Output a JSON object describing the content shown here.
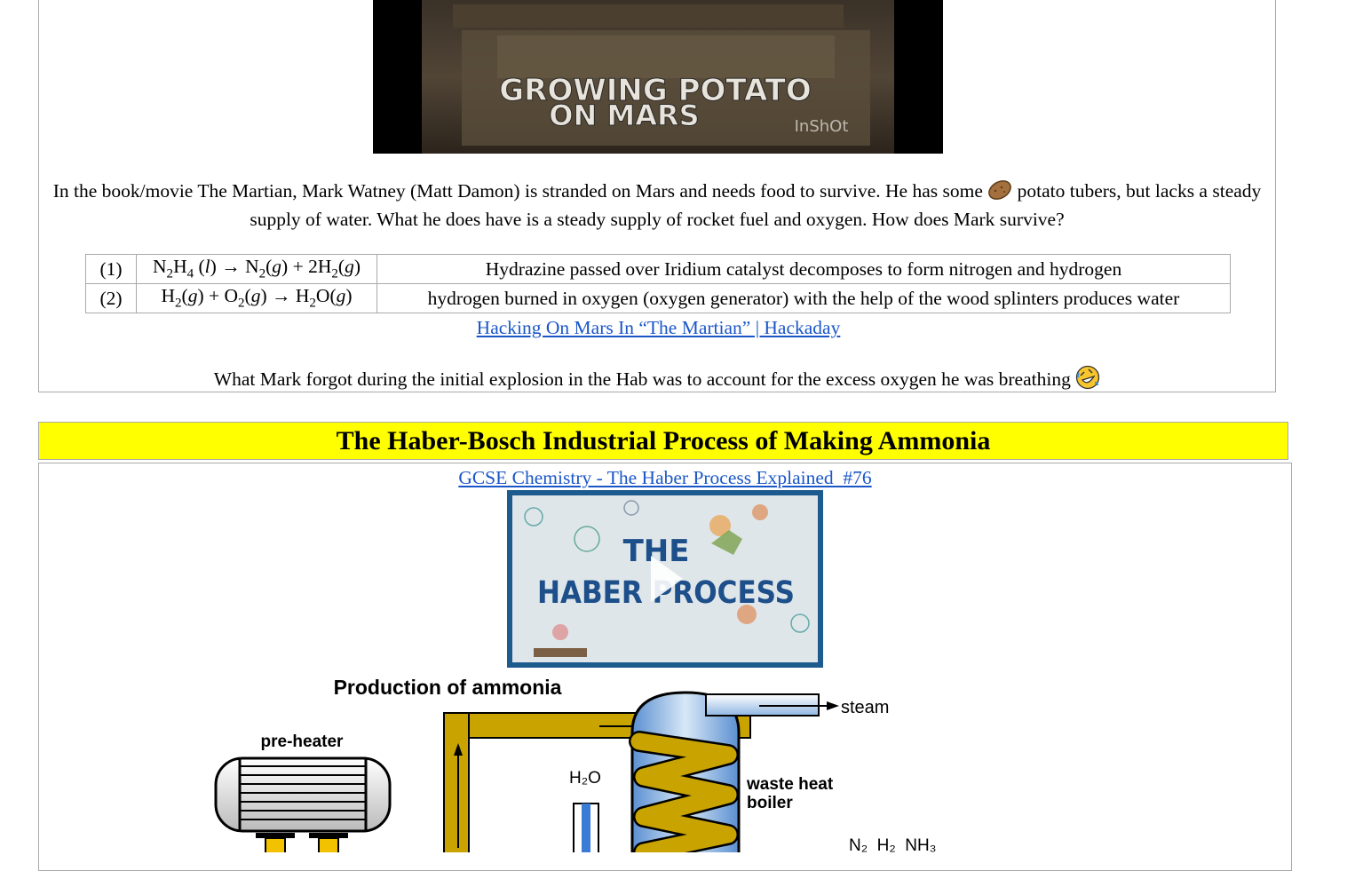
{
  "video1": {
    "title_line1": "GROWING POTATO",
    "title_line2": "ON MARS",
    "watermark": "InShOt"
  },
  "intro": {
    "text_part1": "In the book/movie The Martian, Mark Watney (Matt Damon) is stranded on Mars and needs food to survive. He has some",
    "potato_icon": "potato-emoji",
    "text_part2": "potato tubers, but lacks a steady supply of water. What he does have is a steady supply of rocket fuel and oxygen. How does Mark survive?"
  },
  "reactions": [
    {
      "number": "(1)",
      "description": "Hydrazine passed over Iridium catalyst decomposes to form nitrogen and hydrogen"
    },
    {
      "number": "(2)",
      "description": "hydrogen burned in oxygen (oxygen generator) with the help of the wood splinters produces water"
    }
  ],
  "hackaday_link": "Hacking On Mars In “The Martian” | Hackaday",
  "forgot": {
    "text": "What Mark forgot during the initial explosion in the Hab was to account for the excess oxygen he was breathing",
    "emoji_icon": "rolling-on-floor-laughing-emoji"
  },
  "banner_title": "The Haber-Bosch Industrial Process of Making Ammonia",
  "gcse_link": "GCSE Chemistry - The Haber Process Explained  #76",
  "video2": {
    "title_line1": "THE",
    "title_line2": "HABER PROCESS",
    "play_icon": "play-icon"
  },
  "diagram": {
    "title": "Production of ammonia",
    "preheater_label": "pre-heater",
    "steam_label": "steam",
    "boiler_label_line1": "waste heat",
    "boiler_label_line2": "boiler",
    "water_label": "H₂O",
    "outputs_label": "N₂  H₂  NH₃"
  },
  "colors": {
    "link": "#1a56c8",
    "banner": "#ffff00",
    "pipe": "#c9a400",
    "border": "#a9a9a9"
  }
}
